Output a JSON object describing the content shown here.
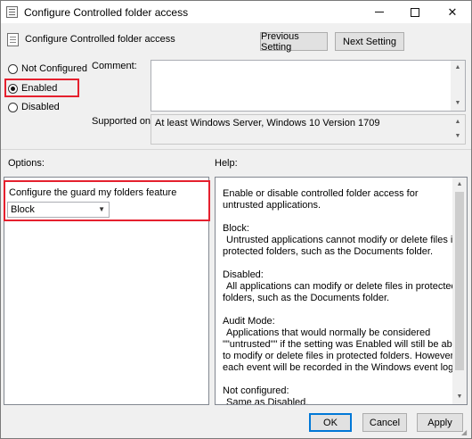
{
  "window": {
    "title": "Configure Controlled folder access",
    "controls": {
      "minimize": "minimize",
      "maximize": "maximize",
      "close": "✕"
    }
  },
  "header": {
    "title": "Configure Controlled folder access",
    "previous_button": "Previous Setting",
    "next_button": "Next Setting"
  },
  "state": {
    "options": [
      {
        "label": "Not Configured",
        "checked": false
      },
      {
        "label": "Enabled",
        "checked": true
      },
      {
        "label": "Disabled",
        "checked": false
      }
    ]
  },
  "comment": {
    "label": "Comment:",
    "value": ""
  },
  "supported": {
    "label": "Supported on:",
    "value": "At least Windows Server, Windows 10 Version 1709"
  },
  "options_section": {
    "label": "Options:",
    "feature_label": "Configure the guard my folders feature",
    "selected": "Block"
  },
  "help": {
    "label": "Help:",
    "paragraphs": [
      [
        "Enable or disable controlled folder access for untrusted applications."
      ],
      [
        "Block:",
        "Untrusted applications cannot modify or delete files in protected folders, such as the Documents folder."
      ],
      [
        "Disabled:",
        "All applications can modify or delete files in protected folders, such as the Documents folder."
      ],
      [
        "Audit Mode:",
        "Applications that would normally be considered \"\"untrusted\"\" if the setting was Enabled will still be able to modify or delete files in protected folders. However, each event will be recorded in the Windows event log."
      ],
      [
        "Not configured:",
        "Same as Disabled."
      ]
    ]
  },
  "footer": {
    "ok": "OK",
    "cancel": "Cancel",
    "apply": "Apply"
  },
  "colors": {
    "highlight_border": "#e5202e",
    "default_button_border": "#0078d7"
  }
}
